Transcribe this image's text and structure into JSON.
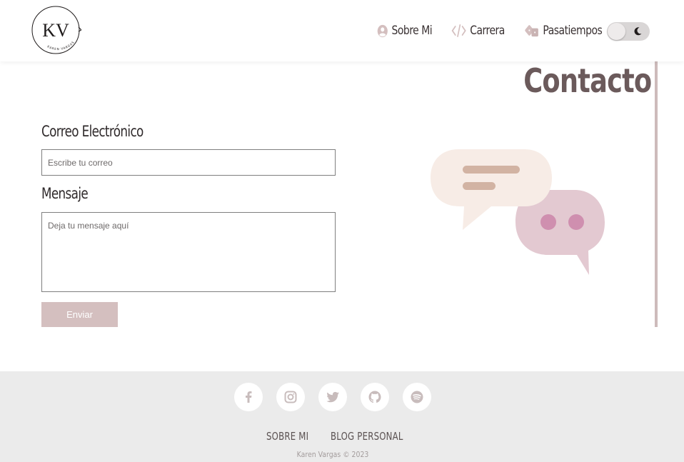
{
  "logo": {
    "initials": "KV",
    "subtitle": "KAREN VARGAS"
  },
  "nav": {
    "items": [
      {
        "label": "Sobre Mi",
        "icon": "user-circle-icon"
      },
      {
        "label": "Carrera",
        "icon": "code-icon"
      },
      {
        "label": "Pasatiempos",
        "icon": "dice-icon"
      }
    ],
    "theme_toggle": {
      "icon": "moon-icon",
      "state": "light"
    }
  },
  "main": {
    "title": "Contacto",
    "email_label": "Correo Electrónico",
    "email_placeholder": "Escribe tu correo",
    "message_label": "Mensaje",
    "message_placeholder": "Deja tu mensaje aquí",
    "submit_label": "Enviar",
    "illustration_icon": "chat-bubbles-icon"
  },
  "footer": {
    "social_icons": [
      "facebook-icon",
      "instagram-icon",
      "twitter-icon",
      "github-icon",
      "spotify-icon"
    ],
    "links": [
      "SOBRE MI",
      "BLOG PERSONAL"
    ],
    "copyright": "Karen Vargas © 2023"
  },
  "colors": {
    "accent": "#d4bfbf",
    "accent_dark": "#cdbbbb",
    "footer_bg": "#ebebeb",
    "bubble_light": "#f7ece6",
    "bubble_pink": "#e3c9d1",
    "dots": "#cf8faf",
    "bars": "#d2b3a3"
  }
}
